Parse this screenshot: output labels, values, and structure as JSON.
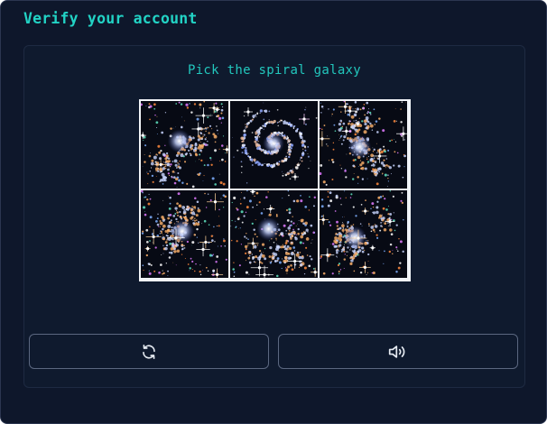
{
  "header": {
    "title": "Verify your account"
  },
  "challenge": {
    "instruction": "Pick the spiral galaxy",
    "tiles": [
      {
        "icon": "cluster-galaxy-image",
        "selected": false
      },
      {
        "icon": "spiral-galaxy-image",
        "selected": false
      },
      {
        "icon": "cluster-galaxy-image",
        "selected": false
      },
      {
        "icon": "cluster-galaxy-image",
        "selected": false
      },
      {
        "icon": "cluster-galaxy-image",
        "selected": false
      },
      {
        "icon": "cluster-galaxy-image",
        "selected": false
      }
    ]
  },
  "controls": {
    "refresh": {
      "icon": "refresh-icon"
    },
    "audio": {
      "icon": "speaker-icon"
    }
  },
  "colors": {
    "background": "#0e172b",
    "accent": "#22d3c5",
    "tile_border": "#f1f4f8",
    "button_border": "#5b6780"
  }
}
